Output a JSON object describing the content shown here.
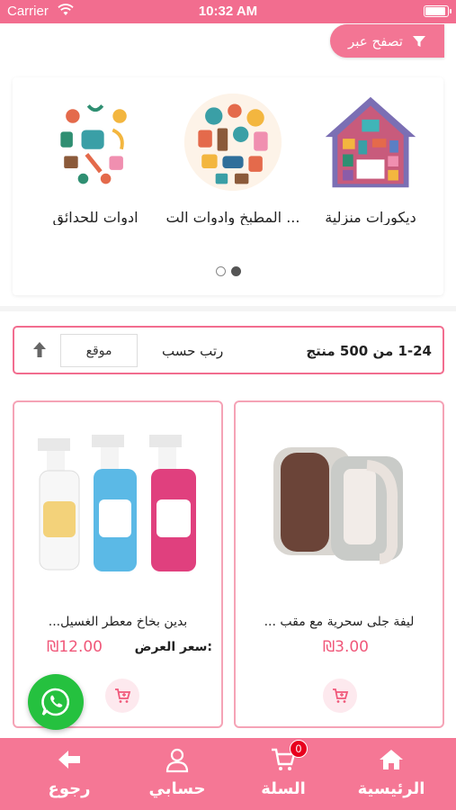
{
  "status_bar": {
    "carrier": "Carrier",
    "time": "10:32 AM"
  },
  "filter_button": {
    "label": "تصفح عبر"
  },
  "categories": [
    {
      "label": "ديكورات منزلية",
      "icon": "house-decor-collage"
    },
    {
      "label": "المطبخ وادوات الت ...",
      "icon": "kitchen-tools-collage"
    },
    {
      "label": "ادوات للحدائق",
      "icon": "garden-tools-collage"
    }
  ],
  "pager": {
    "total": 2,
    "active": 2
  },
  "sort_bar": {
    "count": "1-24 من 500 منتج",
    "sort_label": "رتب حسب",
    "sort_value": "موقع"
  },
  "products": [
    {
      "name": "ليفة جلى سحرية مع مقب ...",
      "price": "₪3.00",
      "offer_label": "",
      "image": "sponge-with-handle"
    },
    {
      "name": "بدين بخاخ معطر الغسيل...",
      "price": "₪12.00",
      "offer_label": "سعر العرض:",
      "image": "spray-bottles"
    }
  ],
  "tab_bar": {
    "home": "الرئيسية",
    "cart": "السلة",
    "cart_badge": "0",
    "account": "حسابي",
    "back": "رجوع"
  },
  "colors": {
    "primary": "#f57795",
    "price": "#f0587a",
    "whatsapp": "#25c13f"
  }
}
